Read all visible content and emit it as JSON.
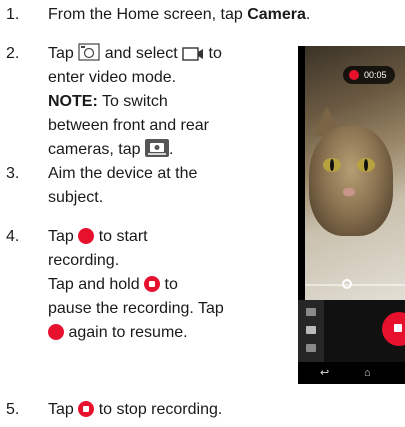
{
  "steps": [
    {
      "num": "1.",
      "pre": "From the Home screen, tap ",
      "bold": "Camera",
      "post": "."
    },
    {
      "num": "2.",
      "l1a": "Tap ",
      "l1b": " and select ",
      "l1c": " to",
      "l2": "enter video mode.",
      "note_label": "NOTE:",
      "note_rest": " To switch",
      "l4": "between front and rear",
      "l5a": "cameras, tap ",
      "l5b": "."
    },
    {
      "num": "3.",
      "l1": "Aim the device at the",
      "l2": "subject."
    },
    {
      "num": "4.",
      "l1a": "Tap ",
      "l1b": " to start",
      "l2": "recording.",
      "l3a": "Tap and hold ",
      "l3b": " to",
      "l4": "pause the recording. Tap",
      "l5": " again to resume."
    },
    {
      "num": "5.",
      "pre": "Tap ",
      "post": " to stop recording."
    }
  ],
  "phone": {
    "timer": "00:05"
  },
  "icons": {
    "camera_switch_mode": "camera-mode-icon",
    "video_mode": "video-mode-icon",
    "switch_camera": "switch-camera-icon",
    "record": "record-icon",
    "pause_stop": "stop-icon"
  },
  "colors": {
    "record_red": "#e8112d",
    "text": "#1a1a1a"
  }
}
